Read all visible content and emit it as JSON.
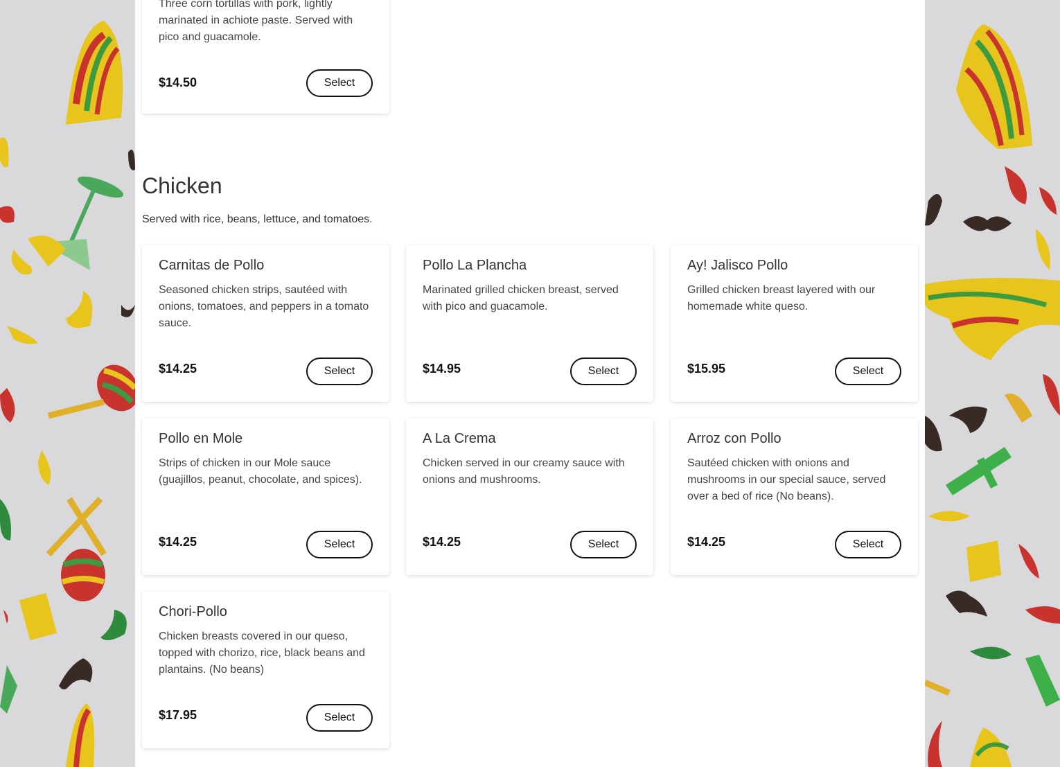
{
  "colors": {
    "page_bg": "#ffffff",
    "pattern_bg": "#d9d9dc",
    "button_border": "#111111"
  },
  "background_icons": [
    "sombrero-icon",
    "chili-pepper-icon",
    "mustache-icon",
    "maraca-icon",
    "cactus-icon",
    "margarita-glass-icon"
  ],
  "previous_item": {
    "description": "Three corn tortillas with pork, lightly marinated in achiote paste. Served with pico and guacamole.",
    "price": "$14.50",
    "button": "Select"
  },
  "section": {
    "title": "Chicken",
    "description": "Served with rice, beans, lettuce, and tomatoes."
  },
  "items": [
    {
      "name": "Carnitas de Pollo",
      "description": "Seasoned chicken strips, sautéed with onions, tomatoes, and peppers in a tomato sauce.",
      "price": "$14.25",
      "button": "Select"
    },
    {
      "name": "Pollo La Plancha",
      "description": "Marinated grilled chicken breast, served with pico and guacamole.",
      "price": "$14.95",
      "button": "Select"
    },
    {
      "name": "Ay! Jalisco Pollo",
      "description": "Grilled chicken breast layered with our homemade white queso.",
      "price": "$15.95",
      "button": "Select"
    },
    {
      "name": "Pollo en Mole",
      "description": "Strips of chicken in our Mole sauce (guajillos, peanut, chocolate, and spices).",
      "price": "$14.25",
      "button": "Select"
    },
    {
      "name": "A La Crema",
      "description": "Chicken served in our creamy sauce with onions and mushrooms.",
      "price": "$14.25",
      "button": "Select"
    },
    {
      "name": "Arroz con Pollo",
      "description": "Sautéed chicken with onions and mushrooms in our special sauce, served over a bed of rice (No beans).",
      "price": "$14.25",
      "button": "Select"
    },
    {
      "name": "Chori-Pollo",
      "description": "Chicken breasts covered in our queso, topped with chorizo, rice, black beans and plantains. (No beans)",
      "price": "$17.95",
      "button": "Select"
    }
  ]
}
